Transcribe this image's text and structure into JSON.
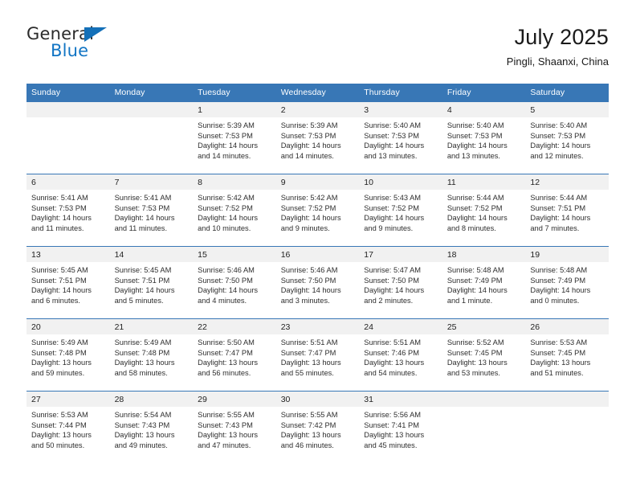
{
  "logo": {
    "word_one": "General",
    "word_two": "Blue",
    "triangle_icon": "triangle-icon"
  },
  "header": {
    "title": "July 2025",
    "subtitle": "Pingli, Shaanxi, China"
  },
  "colors": {
    "header_blue": "#3877b6",
    "daynum_gray": "#f1f1f1",
    "logo_blue": "#1275c4",
    "text": "#2e2e2e"
  },
  "weekday_headers": [
    "Sunday",
    "Monday",
    "Tuesday",
    "Wednesday",
    "Thursday",
    "Friday",
    "Saturday"
  ],
  "labels": {
    "sunrise_prefix": "Sunrise:",
    "sunset_prefix": "Sunset:",
    "daylight_prefix": "Daylight:"
  },
  "weeks": [
    [
      {
        "day": "",
        "sunrise": "",
        "sunset": "",
        "daylight_line1": "",
        "daylight_line2": "",
        "blank": true
      },
      {
        "day": "",
        "sunrise": "",
        "sunset": "",
        "daylight_line1": "",
        "daylight_line2": "",
        "blank": true
      },
      {
        "day": "1",
        "sunrise": "Sunrise: 5:39 AM",
        "sunset": "Sunset: 7:53 PM",
        "daylight_line1": "Daylight: 14 hours",
        "daylight_line2": "and 14 minutes."
      },
      {
        "day": "2",
        "sunrise": "Sunrise: 5:39 AM",
        "sunset": "Sunset: 7:53 PM",
        "daylight_line1": "Daylight: 14 hours",
        "daylight_line2": "and 14 minutes."
      },
      {
        "day": "3",
        "sunrise": "Sunrise: 5:40 AM",
        "sunset": "Sunset: 7:53 PM",
        "daylight_line1": "Daylight: 14 hours",
        "daylight_line2": "and 13 minutes."
      },
      {
        "day": "4",
        "sunrise": "Sunrise: 5:40 AM",
        "sunset": "Sunset: 7:53 PM",
        "daylight_line1": "Daylight: 14 hours",
        "daylight_line2": "and 13 minutes."
      },
      {
        "day": "5",
        "sunrise": "Sunrise: 5:40 AM",
        "sunset": "Sunset: 7:53 PM",
        "daylight_line1": "Daylight: 14 hours",
        "daylight_line2": "and 12 minutes."
      }
    ],
    [
      {
        "day": "6",
        "sunrise": "Sunrise: 5:41 AM",
        "sunset": "Sunset: 7:53 PM",
        "daylight_line1": "Daylight: 14 hours",
        "daylight_line2": "and 11 minutes."
      },
      {
        "day": "7",
        "sunrise": "Sunrise: 5:41 AM",
        "sunset": "Sunset: 7:53 PM",
        "daylight_line1": "Daylight: 14 hours",
        "daylight_line2": "and 11 minutes."
      },
      {
        "day": "8",
        "sunrise": "Sunrise: 5:42 AM",
        "sunset": "Sunset: 7:52 PM",
        "daylight_line1": "Daylight: 14 hours",
        "daylight_line2": "and 10 minutes."
      },
      {
        "day": "9",
        "sunrise": "Sunrise: 5:42 AM",
        "sunset": "Sunset: 7:52 PM",
        "daylight_line1": "Daylight: 14 hours",
        "daylight_line2": "and 9 minutes."
      },
      {
        "day": "10",
        "sunrise": "Sunrise: 5:43 AM",
        "sunset": "Sunset: 7:52 PM",
        "daylight_line1": "Daylight: 14 hours",
        "daylight_line2": "and 9 minutes."
      },
      {
        "day": "11",
        "sunrise": "Sunrise: 5:44 AM",
        "sunset": "Sunset: 7:52 PM",
        "daylight_line1": "Daylight: 14 hours",
        "daylight_line2": "and 8 minutes."
      },
      {
        "day": "12",
        "sunrise": "Sunrise: 5:44 AM",
        "sunset": "Sunset: 7:51 PM",
        "daylight_line1": "Daylight: 14 hours",
        "daylight_line2": "and 7 minutes."
      }
    ],
    [
      {
        "day": "13",
        "sunrise": "Sunrise: 5:45 AM",
        "sunset": "Sunset: 7:51 PM",
        "daylight_line1": "Daylight: 14 hours",
        "daylight_line2": "and 6 minutes."
      },
      {
        "day": "14",
        "sunrise": "Sunrise: 5:45 AM",
        "sunset": "Sunset: 7:51 PM",
        "daylight_line1": "Daylight: 14 hours",
        "daylight_line2": "and 5 minutes."
      },
      {
        "day": "15",
        "sunrise": "Sunrise: 5:46 AM",
        "sunset": "Sunset: 7:50 PM",
        "daylight_line1": "Daylight: 14 hours",
        "daylight_line2": "and 4 minutes."
      },
      {
        "day": "16",
        "sunrise": "Sunrise: 5:46 AM",
        "sunset": "Sunset: 7:50 PM",
        "daylight_line1": "Daylight: 14 hours",
        "daylight_line2": "and 3 minutes."
      },
      {
        "day": "17",
        "sunrise": "Sunrise: 5:47 AM",
        "sunset": "Sunset: 7:50 PM",
        "daylight_line1": "Daylight: 14 hours",
        "daylight_line2": "and 2 minutes."
      },
      {
        "day": "18",
        "sunrise": "Sunrise: 5:48 AM",
        "sunset": "Sunset: 7:49 PM",
        "daylight_line1": "Daylight: 14 hours",
        "daylight_line2": "and 1 minute."
      },
      {
        "day": "19",
        "sunrise": "Sunrise: 5:48 AM",
        "sunset": "Sunset: 7:49 PM",
        "daylight_line1": "Daylight: 14 hours",
        "daylight_line2": "and 0 minutes."
      }
    ],
    [
      {
        "day": "20",
        "sunrise": "Sunrise: 5:49 AM",
        "sunset": "Sunset: 7:48 PM",
        "daylight_line1": "Daylight: 13 hours",
        "daylight_line2": "and 59 minutes."
      },
      {
        "day": "21",
        "sunrise": "Sunrise: 5:49 AM",
        "sunset": "Sunset: 7:48 PM",
        "daylight_line1": "Daylight: 13 hours",
        "daylight_line2": "and 58 minutes."
      },
      {
        "day": "22",
        "sunrise": "Sunrise: 5:50 AM",
        "sunset": "Sunset: 7:47 PM",
        "daylight_line1": "Daylight: 13 hours",
        "daylight_line2": "and 56 minutes."
      },
      {
        "day": "23",
        "sunrise": "Sunrise: 5:51 AM",
        "sunset": "Sunset: 7:47 PM",
        "daylight_line1": "Daylight: 13 hours",
        "daylight_line2": "and 55 minutes."
      },
      {
        "day": "24",
        "sunrise": "Sunrise: 5:51 AM",
        "sunset": "Sunset: 7:46 PM",
        "daylight_line1": "Daylight: 13 hours",
        "daylight_line2": "and 54 minutes."
      },
      {
        "day": "25",
        "sunrise": "Sunrise: 5:52 AM",
        "sunset": "Sunset: 7:45 PM",
        "daylight_line1": "Daylight: 13 hours",
        "daylight_line2": "and 53 minutes."
      },
      {
        "day": "26",
        "sunrise": "Sunrise: 5:53 AM",
        "sunset": "Sunset: 7:45 PM",
        "daylight_line1": "Daylight: 13 hours",
        "daylight_line2": "and 51 minutes."
      }
    ],
    [
      {
        "day": "27",
        "sunrise": "Sunrise: 5:53 AM",
        "sunset": "Sunset: 7:44 PM",
        "daylight_line1": "Daylight: 13 hours",
        "daylight_line2": "and 50 minutes."
      },
      {
        "day": "28",
        "sunrise": "Sunrise: 5:54 AM",
        "sunset": "Sunset: 7:43 PM",
        "daylight_line1": "Daylight: 13 hours",
        "daylight_line2": "and 49 minutes."
      },
      {
        "day": "29",
        "sunrise": "Sunrise: 5:55 AM",
        "sunset": "Sunset: 7:43 PM",
        "daylight_line1": "Daylight: 13 hours",
        "daylight_line2": "and 47 minutes."
      },
      {
        "day": "30",
        "sunrise": "Sunrise: 5:55 AM",
        "sunset": "Sunset: 7:42 PM",
        "daylight_line1": "Daylight: 13 hours",
        "daylight_line2": "and 46 minutes."
      },
      {
        "day": "31",
        "sunrise": "Sunrise: 5:56 AM",
        "sunset": "Sunset: 7:41 PM",
        "daylight_line1": "Daylight: 13 hours",
        "daylight_line2": "and 45 minutes."
      },
      {
        "day": "",
        "sunrise": "",
        "sunset": "",
        "daylight_line1": "",
        "daylight_line2": "",
        "blank": true
      },
      {
        "day": "",
        "sunrise": "",
        "sunset": "",
        "daylight_line1": "",
        "daylight_line2": "",
        "blank": true
      }
    ]
  ]
}
